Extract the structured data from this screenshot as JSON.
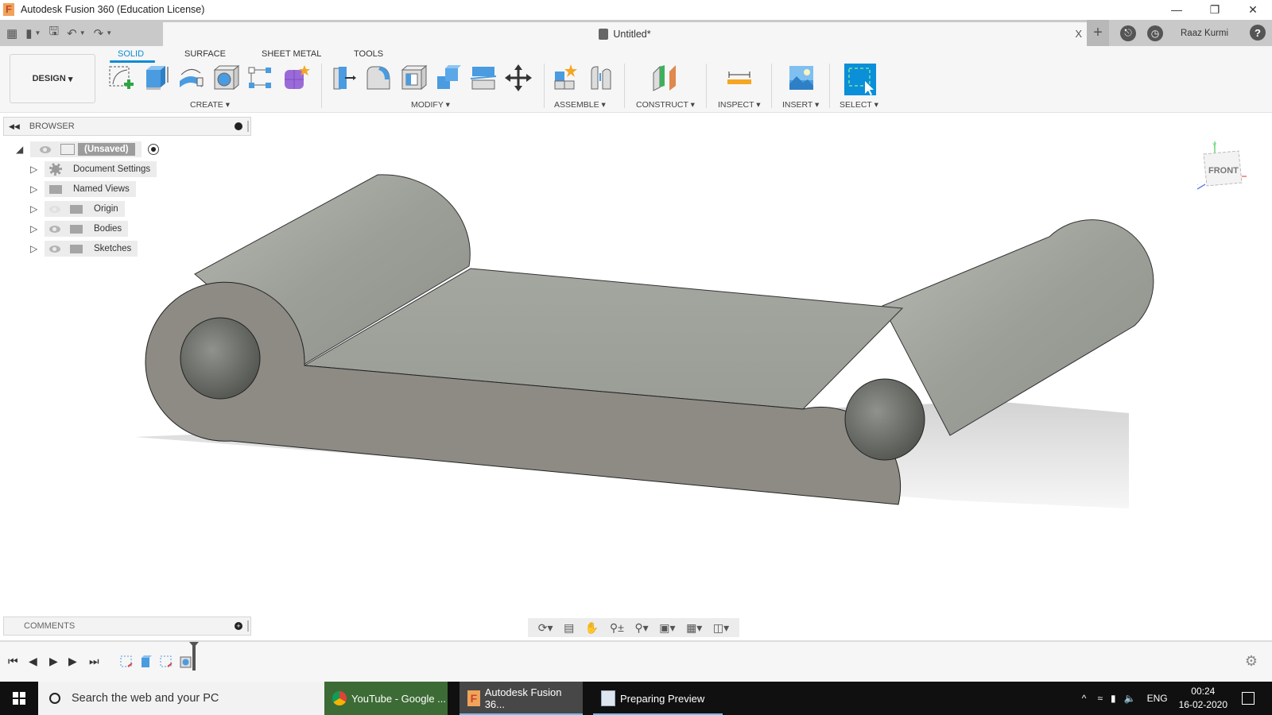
{
  "window": {
    "title": "Autodesk Fusion 360 (Education License)",
    "controls": [
      "minimize",
      "restore",
      "close"
    ]
  },
  "quick_access": {
    "items": [
      "grid-menu-icon",
      "file-icon",
      "save-icon",
      "undo-icon",
      "redo-icon"
    ]
  },
  "document_tab": {
    "name": "Untitled*",
    "close_label": "X"
  },
  "account": {
    "user_name": "Raaz Kurmi",
    "help_label": "?"
  },
  "ribbon": {
    "workspace_label": "DESIGN",
    "tabs": [
      {
        "label": "SOLID",
        "active": true
      },
      {
        "label": "SURFACE",
        "active": false
      },
      {
        "label": "SHEET METAL",
        "active": false
      },
      {
        "label": "TOOLS",
        "active": false
      }
    ],
    "groups": [
      {
        "label": "CREATE",
        "tools": [
          "create-sketch",
          "extrude",
          "revolve",
          "hole",
          "rectangular-pattern",
          "create-form"
        ]
      },
      {
        "label": "MODIFY",
        "tools": [
          "press-pull",
          "fillet",
          "shell",
          "combine",
          "split-body",
          "move-copy"
        ]
      },
      {
        "label": "ASSEMBLE",
        "tools": [
          "new-component",
          "joint"
        ]
      },
      {
        "label": "CONSTRUCT",
        "tools": [
          "offset-plane"
        ]
      },
      {
        "label": "INSPECT",
        "tools": [
          "measure"
        ]
      },
      {
        "label": "INSERT",
        "tools": [
          "insert-image"
        ]
      },
      {
        "label": "SELECT",
        "tools": [
          "select"
        ]
      }
    ],
    "accent_color": "#0f8bd5"
  },
  "browser": {
    "title": "BROWSER",
    "root": {
      "label": "(Unsaved)"
    },
    "items": [
      {
        "label": "Document Settings",
        "icon": "gear-icon",
        "visible": null
      },
      {
        "label": "Named Views",
        "icon": "folder-icon",
        "visible": null
      },
      {
        "label": "Origin",
        "icon": "folder-icon",
        "visible": false
      },
      {
        "label": "Bodies",
        "icon": "folder-icon",
        "visible": true
      },
      {
        "label": "Sketches",
        "icon": "folder-icon",
        "visible": true
      }
    ]
  },
  "viewcube": {
    "face": "FRONT",
    "axes": {
      "x": "X",
      "y": "Y",
      "z": "Z"
    }
  },
  "viewport": {
    "model": "hinge-plate-with-two-hollow-cylinders",
    "body_color": "#8d8b84",
    "top_color": "#a3a59e"
  },
  "comments": {
    "title": "COMMENTS"
  },
  "nav_toolbar": {
    "items": [
      "orbit-icon",
      "look-at-icon",
      "pan-icon",
      "zoom-icon",
      "fit-icon",
      "display-settings-icon",
      "grid-icon",
      "viewports-icon"
    ]
  },
  "timeline": {
    "controls": [
      "go-to-start",
      "step-back",
      "play",
      "step-forward",
      "go-to-end"
    ],
    "features": [
      "sketch",
      "extrude",
      "sketch",
      "hole"
    ]
  },
  "taskbar": {
    "search_placeholder": "Search the web and your PC",
    "apps": [
      {
        "label": "YouTube - Google ...",
        "active": false
      },
      {
        "label": "Autodesk Fusion 36...",
        "active": true
      },
      {
        "label": "Preparing Preview",
        "active": false
      }
    ],
    "language": "ENG",
    "time": "00:24",
    "date": "16-02-2020"
  }
}
